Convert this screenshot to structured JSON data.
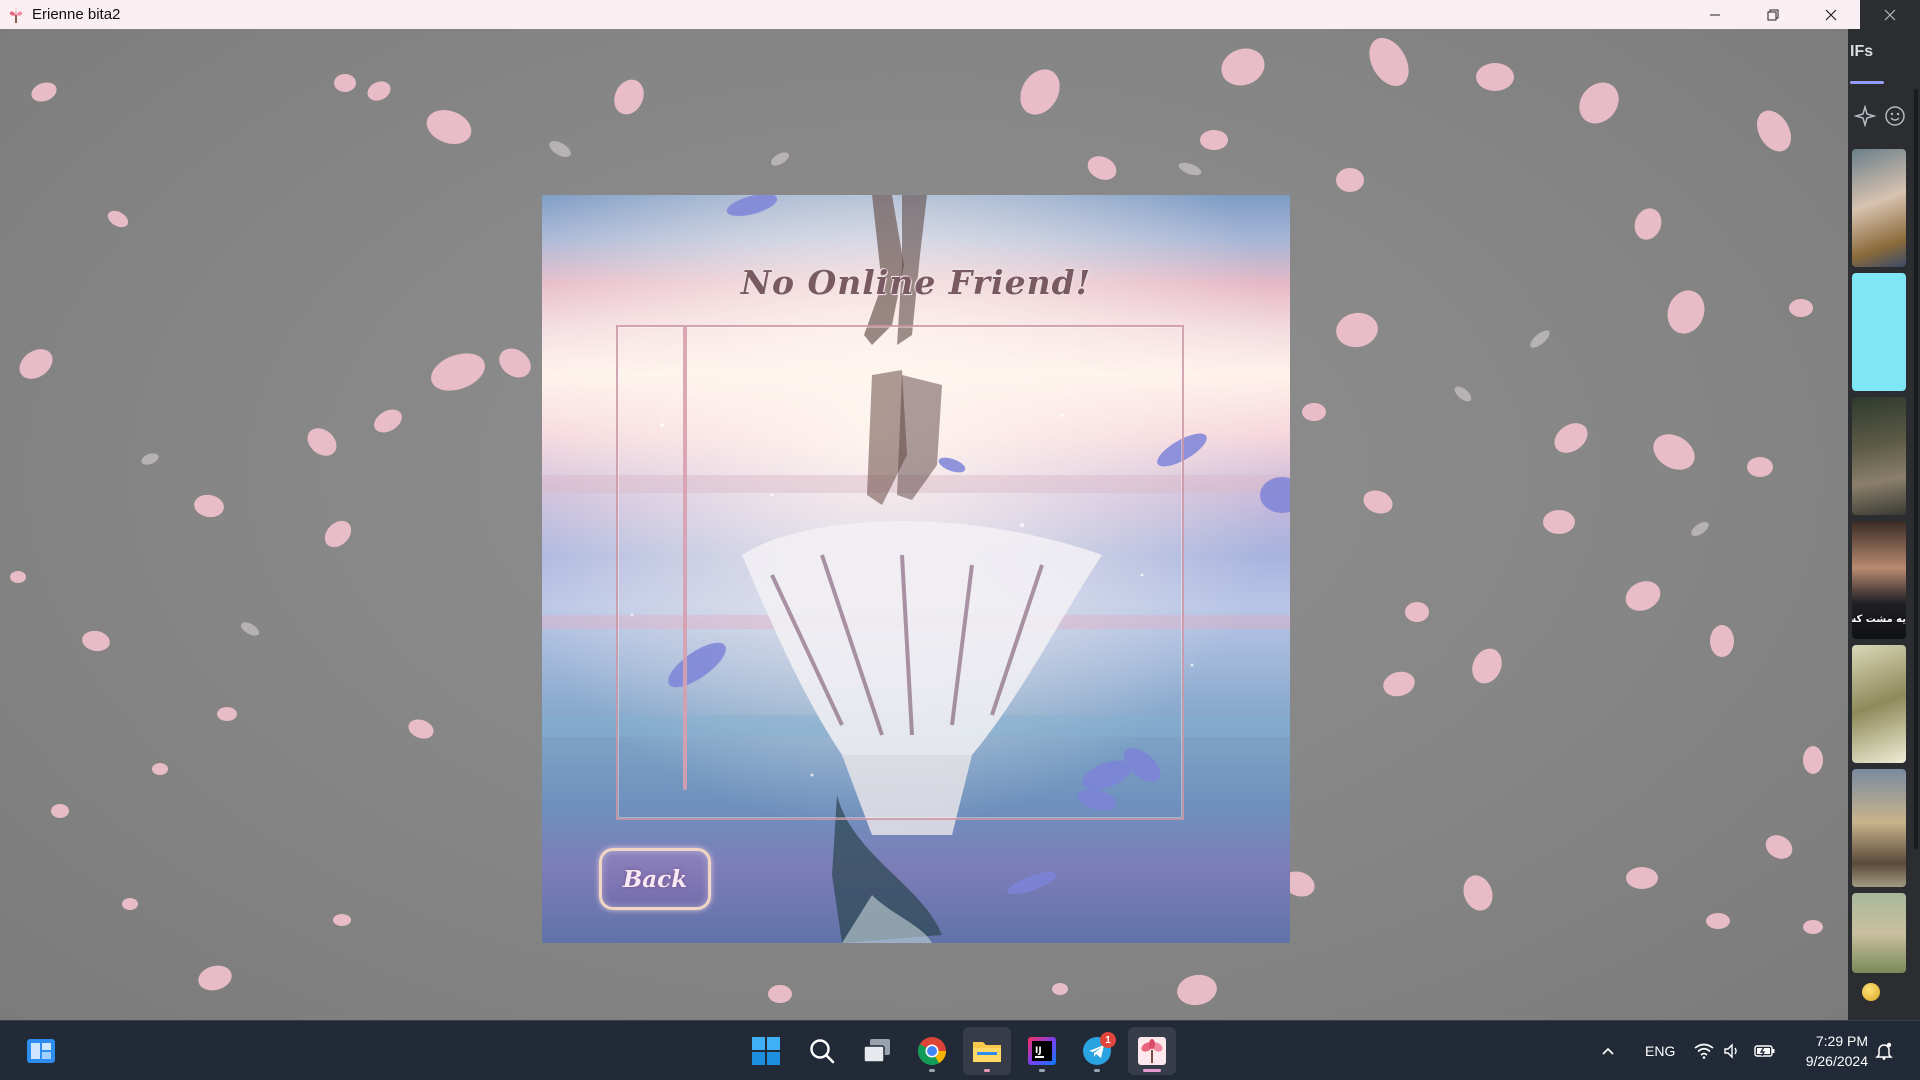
{
  "window": {
    "title": "Erienne bita2"
  },
  "dialog": {
    "title": "No Online Friend!",
    "back_label": "Back"
  },
  "side_panel": {
    "tab_label": "GIFs",
    "tab_visible_text": "IFs",
    "gif_caption": "یه مشت کس"
  },
  "taskbar": {
    "language": "ENG",
    "time": "7:29 PM",
    "date": "9/26/2024",
    "telegram_badge": "1"
  },
  "colors": {
    "background_gray": "#8a8a8a",
    "petal_pink": "#f6c7d3",
    "dialog_border": "#cd96a5",
    "back_button_border": "#f2d6c4",
    "taskbar": "#232a37",
    "accent_purple": "#949cf7"
  }
}
